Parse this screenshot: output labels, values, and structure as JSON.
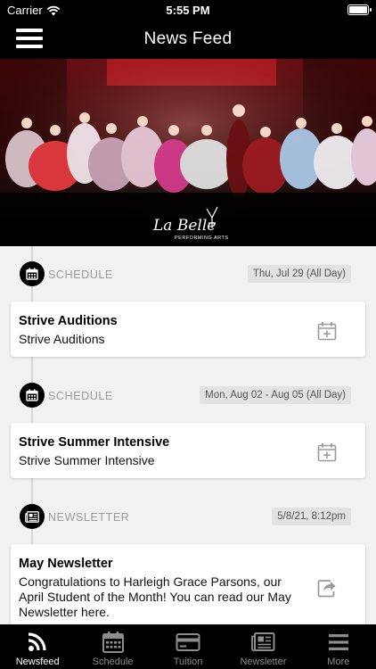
{
  "status_bar": {
    "carrier": "Carrier",
    "time": "5:55 PM"
  },
  "nav": {
    "title": "News Feed"
  },
  "hero": {
    "logo_script": "La Belle",
    "logo_caption": "PERFORMING ARTS"
  },
  "feed": [
    {
      "category": "SCHEDULE",
      "icon": "calendar-icon",
      "date": "Thu, Jul 29 (All Day)",
      "title": "Strive Auditions",
      "subtitle": "Strive Auditions",
      "action_icon": "add-to-calendar-icon"
    },
    {
      "category": "SCHEDULE",
      "icon": "calendar-icon",
      "date": "Mon, Aug 02 - Aug 05 (All Day)",
      "title": "Strive Summer Intensive",
      "subtitle": "Strive Summer Intensive",
      "action_icon": "add-to-calendar-icon"
    },
    {
      "category": "NEWSLETTER",
      "icon": "newspaper-icon",
      "date": "5/8/21, 8:12pm",
      "title": "May Newsletter",
      "subtitle": "Congratulations to Harleigh Grace Parsons, our April Student of the Month! You can read our May Newsletter here.",
      "action_icon": "share-icon"
    }
  ],
  "tabs": [
    {
      "label": "Newsfeed",
      "icon": "rss-icon",
      "active": true
    },
    {
      "label": "Schedule",
      "icon": "calendar-icon",
      "active": false
    },
    {
      "label": "Tuition",
      "icon": "credit-card-icon",
      "active": false
    },
    {
      "label": "Newsletter",
      "icon": "newspaper-icon",
      "active": false
    },
    {
      "label": "More",
      "icon": "menu-icon",
      "active": false
    }
  ],
  "colors": {
    "bar": "#000000",
    "active_tab": "#ffffff",
    "inactive_tab": "#8c8c8c",
    "stage_red": "#b0141a"
  }
}
